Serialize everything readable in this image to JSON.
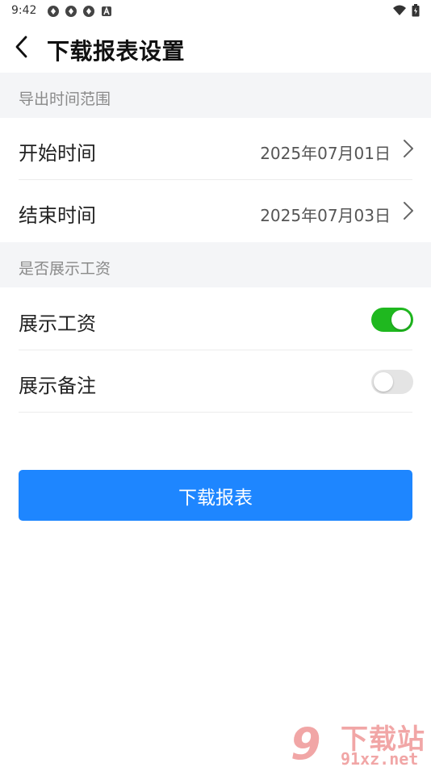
{
  "status_bar": {
    "time": "9:42",
    "notification_icons": [
      "sync-icon",
      "sync-icon",
      "sync-icon",
      "a-icon"
    ],
    "right_icons": [
      "wifi-icon",
      "battery-icon"
    ]
  },
  "nav": {
    "title": "下载报表设置"
  },
  "sections": {
    "time_range_header": "导出时间范围",
    "start": {
      "label": "开始时间",
      "value": "2025年07月01日"
    },
    "end": {
      "label": "结束时间",
      "value": "2025年07月03日"
    },
    "display_header": "是否展示工资",
    "show_salary": {
      "label": "展示工资",
      "enabled": true
    },
    "show_notes": {
      "label": "展示备注",
      "enabled": false
    }
  },
  "download_button_label": "下载报表",
  "watermark": {
    "logo": "9",
    "title": "下载站",
    "url": "91xz.net"
  },
  "colors": {
    "accent": "#1e86ff",
    "toggle_on": "#1fb81f",
    "toggle_off": "#e4e4e4",
    "section_bg": "#f4f5f7"
  }
}
